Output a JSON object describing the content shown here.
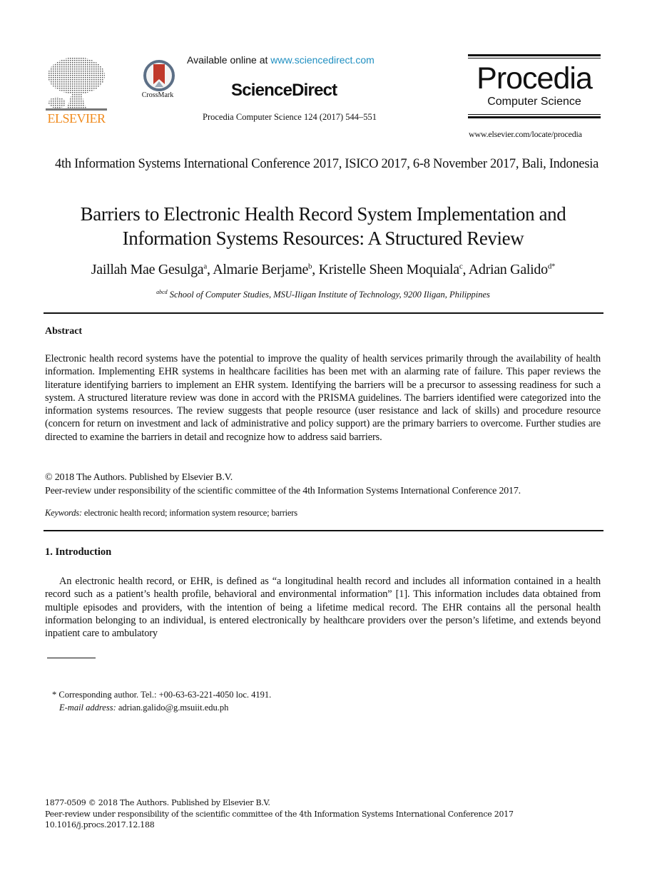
{
  "header": {
    "publisher_logo_text": "ELSEVIER",
    "crossmark_label": "CrossMark",
    "available_prefix": "Available online at ",
    "available_link": "www.sciencedirect.com",
    "platform_name": "ScienceDirect",
    "journal_reference": "Procedia Computer Science 124 (2017) 544–551",
    "journal_brand": "Procedia",
    "journal_subtitle": "Computer Science",
    "journal_url": "www.elsevier.com/locate/procedia",
    "colors": {
      "elsevier_orange": "#f08a1c",
      "link_blue": "#1f8fc1",
      "crossmark_red": "#c0392b"
    }
  },
  "paper": {
    "conference": "4th Information Systems International Conference 2017, ISICO 2017, 6-8 November 2017, Bali, Indonesia",
    "title_line1": "Barriers to Electronic Health Record System Implementation and",
    "title_line2": "Information Systems Resources: A Structured Review",
    "authors": [
      {
        "name": "Jaillah Mae Gesulga",
        "sup": "a",
        "sep": ", "
      },
      {
        "name": "Almarie Berjame",
        "sup": "b",
        "sep": ", "
      },
      {
        "name": "Kristelle Sheen Moquiala",
        "sup": "c",
        "sep": ", "
      },
      {
        "name": "Adrian Galido",
        "sup": "d*",
        "sep": ""
      }
    ],
    "affiliation_sup": "abcd",
    "affiliation": "School of Computer Studies, MSU-Iligan Institute of Technology, 9200 Iligan, Philippines"
  },
  "abstract": {
    "heading": "Abstract",
    "body": "Electronic health record systems have the potential to improve the quality of health services primarily through the availability of health information. Implementing EHR systems in healthcare facilities has been met with an alarming rate of failure. This paper reviews the literature identifying barriers to implement an EHR system. Identifying the barriers will be a precursor to assessing readiness for such a system. A structured literature review was done in accord with the PRISMA guidelines. The barriers identified were categorized into the information systems resources. The review suggests that people resource (user resistance and lack of skills) and procedure resource (concern for return on investment and lack of administrative and policy support) are the primary barriers to overcome. Further studies are directed to examine the barriers in detail and recognize how to address said barriers.",
    "copyright_line1": "© 2018 The Authors. Published by Elsevier B.V.",
    "copyright_line2": "Peer-review under responsibility of the scientific committee of the 4th Information Systems International Conference 2017.",
    "keywords_label": "Keywords:",
    "keywords": " electronic health record; information system resource; barriers"
  },
  "introduction": {
    "heading": "1. Introduction",
    "body": "An electronic health record, or EHR, is defined as “a longitudinal health record and includes all information contained in a health record such as a patient’s health profile, behavioral and environmental information” [1]. This information includes data obtained from multiple episodes and providers, with the intention of being a lifetime medical record. The EHR contains all the personal health information belonging to an individual, is entered electronically by healthcare providers over the person’s lifetime, and extends beyond inpatient care to ambulatory"
  },
  "footnote": {
    "corresponding": "* Corresponding author. Tel.: +00-63-63-221-4050 loc. 4191.",
    "email_label": "E-mail address:",
    "email": " adrian.galido@g.msuiit.edu.ph"
  },
  "bottom": {
    "line1": "1877-0509 © 2018 The Authors. Published by Elsevier B.V.",
    "line2": "Peer-review under responsibility of the scientific committee of the 4th Information Systems International Conference 2017",
    "line3": "10.1016/j.procs.2017.12.188"
  }
}
